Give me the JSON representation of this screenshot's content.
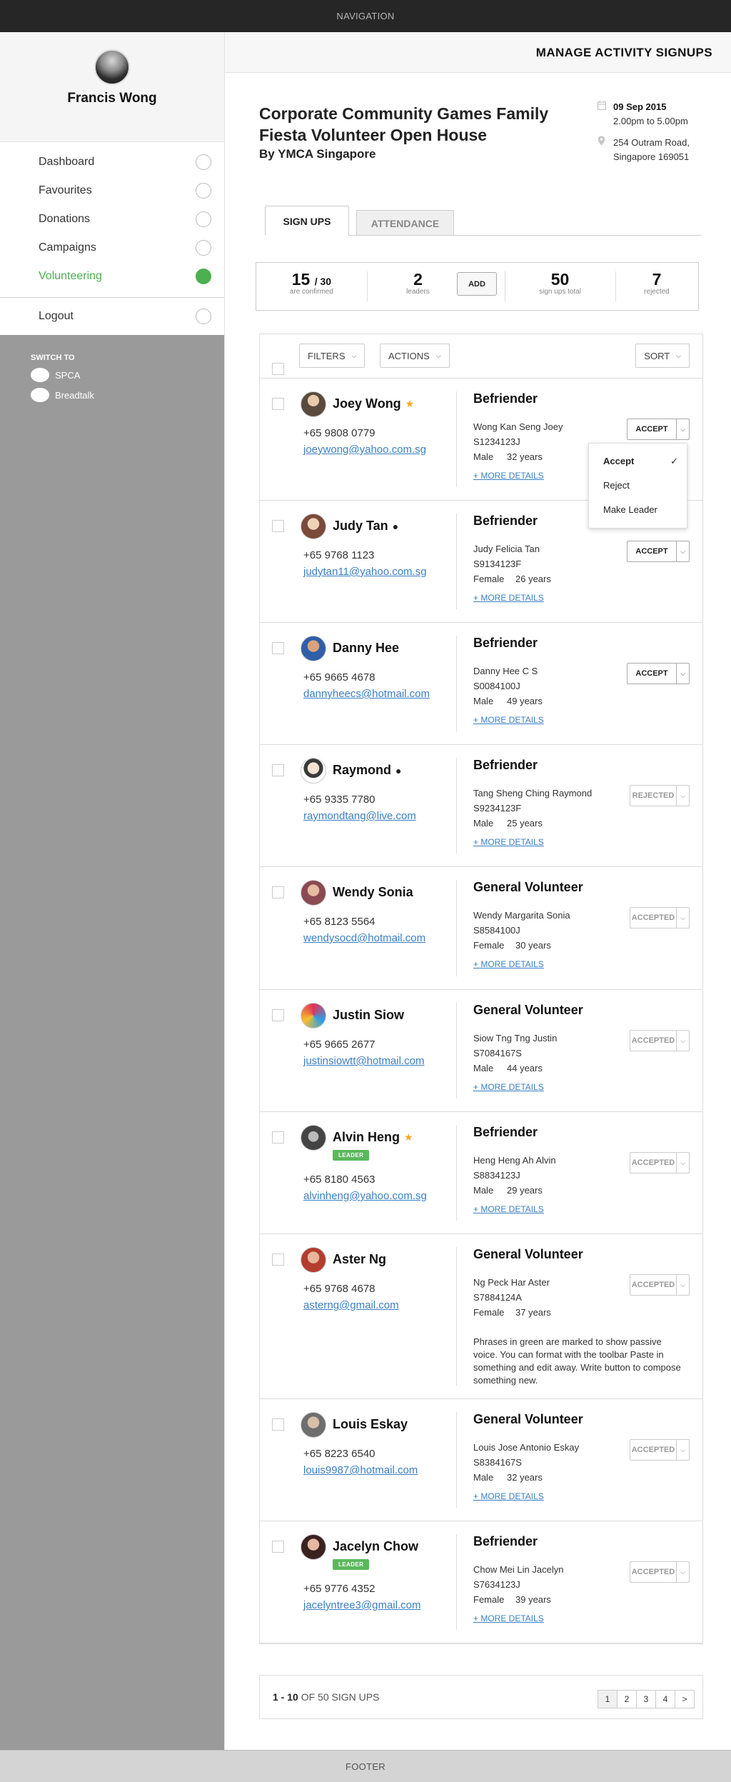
{
  "topbar": {
    "label": "NAVIGATION"
  },
  "footer": {
    "label": "FOOTER"
  },
  "sidebar": {
    "user_name": "Francis Wong",
    "items": [
      {
        "label": "Dashboard"
      },
      {
        "label": "Favourites"
      },
      {
        "label": "Donations"
      },
      {
        "label": "Campaigns"
      },
      {
        "label": "Volunteering",
        "active": true
      }
    ],
    "logout": "Logout",
    "switch_title": "SWITCH TO",
    "switch_items": [
      {
        "label": "SPCA"
      },
      {
        "label": "Breadtalk"
      }
    ]
  },
  "header": {
    "title": "MANAGE ACTIVITY SIGNUPS"
  },
  "event": {
    "title": "Corporate Community Games Family Fiesta Volunteer Open House",
    "organizer": "By YMCA Singapore",
    "date": "09 Sep 2015",
    "time": "2.00pm to 5.00pm",
    "address_line1": "254 Outram Road,",
    "address_line2": "Singapore 169051"
  },
  "tabs": [
    {
      "label": "SIGN UPS"
    },
    {
      "label": "ATTENDANCE"
    }
  ],
  "stats": {
    "confirmed": "15",
    "confirmed_total": "/ 30",
    "confirmed_label": "are confirmed",
    "leaders": "2",
    "leaders_label": "leaders",
    "add_label": "ADD",
    "total": "50",
    "total_label": "sign ups total",
    "rejected": "7",
    "rejected_label": "rejected"
  },
  "toolbar": {
    "filters": "FILTERS",
    "actions": "ACTIONS",
    "sort": "SORT"
  },
  "dropdown": {
    "items": [
      "Accept",
      "Reject",
      "Make Leader"
    ],
    "selected": "Accept",
    "check": "✓"
  },
  "more_label": "+ MORE DETAILS",
  "signups": [
    {
      "name": "Joey Wong",
      "badge": "star",
      "phone": "+65 9808 0779",
      "email": "joeywong@yahoo.com.sg",
      "role": "Befriender",
      "full_name": "Wong Kan Seng Joey",
      "nric": "S1234123J",
      "gender": "Male",
      "age": "32 years",
      "action": "ACCEPT",
      "action_style": "active"
    },
    {
      "name": "Judy Tan",
      "badge": "bomb",
      "phone": "+65 9768 1123",
      "email": "judytan11@yahoo.com.sg",
      "role": "Befriender",
      "full_name": "Judy Felicia Tan",
      "nric": "S9134123F",
      "gender": "Female",
      "age": "26 years",
      "action": "ACCEPT",
      "action_style": "active"
    },
    {
      "name": "Danny Hee",
      "badge": "",
      "phone": "+65 9665 4678",
      "email": "dannyheecs@hotmail.com",
      "role": "Befriender",
      "full_name": "Danny Hee C S",
      "nric": "S0084100J",
      "gender": "Male",
      "age": "49 years",
      "action": "ACCEPT",
      "action_style": "active"
    },
    {
      "name": "Raymond",
      "badge": "bomb",
      "phone": "+65 9335 7780",
      "email": "raymondtang@live.com",
      "role": "Befriender",
      "full_name": "Tang Sheng Ching Raymond",
      "nric": "S9234123F",
      "gender": "Male",
      "age": "25 years",
      "action": "REJECTED",
      "action_style": "muted"
    },
    {
      "name": "Wendy Sonia",
      "badge": "",
      "phone": "+65 8123 5564",
      "email": "wendysocd@hotmail.com",
      "role": "General Volunteer",
      "full_name": "Wendy Margarita Sonia",
      "nric": "S8584100J",
      "gender": "Female",
      "age": "30 years",
      "action": "ACCEPTED",
      "action_style": "muted"
    },
    {
      "name": "Justin Siow",
      "badge": "",
      "phone": "+65 9665 2677",
      "email": "justinsiowtt@hotmail.com",
      "role": "General Volunteer",
      "full_name": "Siow Tng Tng Justin",
      "nric": "S7084167S",
      "gender": "Male",
      "age": "44 years",
      "action": "ACCEPTED",
      "action_style": "muted"
    },
    {
      "name": "Alvin Heng",
      "badge": "star",
      "leader": "LEADER",
      "phone": "+65 8180 4563",
      "email": "alvinheng@yahoo.com.sg",
      "role": "Befriender",
      "full_name": "Heng Heng Ah Alvin",
      "nric": "S8834123J",
      "gender": "Male",
      "age": "29 years",
      "action": "ACCEPTED",
      "action_style": "muted"
    },
    {
      "name": "Aster Ng",
      "badge": "",
      "phone": "+65 9768 4678",
      "email": "asterng@gmail.com",
      "role": "General Volunteer",
      "full_name": "Ng Peck Har Aster",
      "nric": "S7884124A",
      "gender": "Female",
      "age": "37 years",
      "note": "Phrases in green are marked to show passive voice. You can format with the toolbar Paste in something and edit away. Write button to compose something new.",
      "action": "ACCEPTED",
      "action_style": "muted"
    },
    {
      "name": "Louis Eskay",
      "badge": "",
      "phone": "+65 8223 6540",
      "email": "louis9987@hotmail.com",
      "role": "General Volunteer",
      "full_name": "Louis Jose Antonio Eskay",
      "nric": "S8384167S",
      "gender": "Male",
      "age": "32 years",
      "action": "ACCEPTED",
      "action_style": "muted"
    },
    {
      "name": "Jacelyn Chow",
      "badge": "",
      "leader": "LEADER",
      "phone": "+65 9776 4352",
      "email": "jacelyntree3@gmail.com",
      "role": "Befriender",
      "full_name": "Chow Mei Lin Jacelyn",
      "nric": "S7634123J",
      "gender": "Female",
      "age": "39 years",
      "action": "ACCEPTED",
      "action_style": "muted"
    }
  ],
  "pagination": {
    "range": "1 - 10",
    "of": "OF",
    "total": "50",
    "suffix": "SIGN UPS",
    "pages": [
      "1",
      "2",
      "3",
      "4",
      ">"
    ]
  },
  "colors": {
    "accent": "#4caf50",
    "link": "#3b7fc4",
    "star": "#f5a623"
  }
}
